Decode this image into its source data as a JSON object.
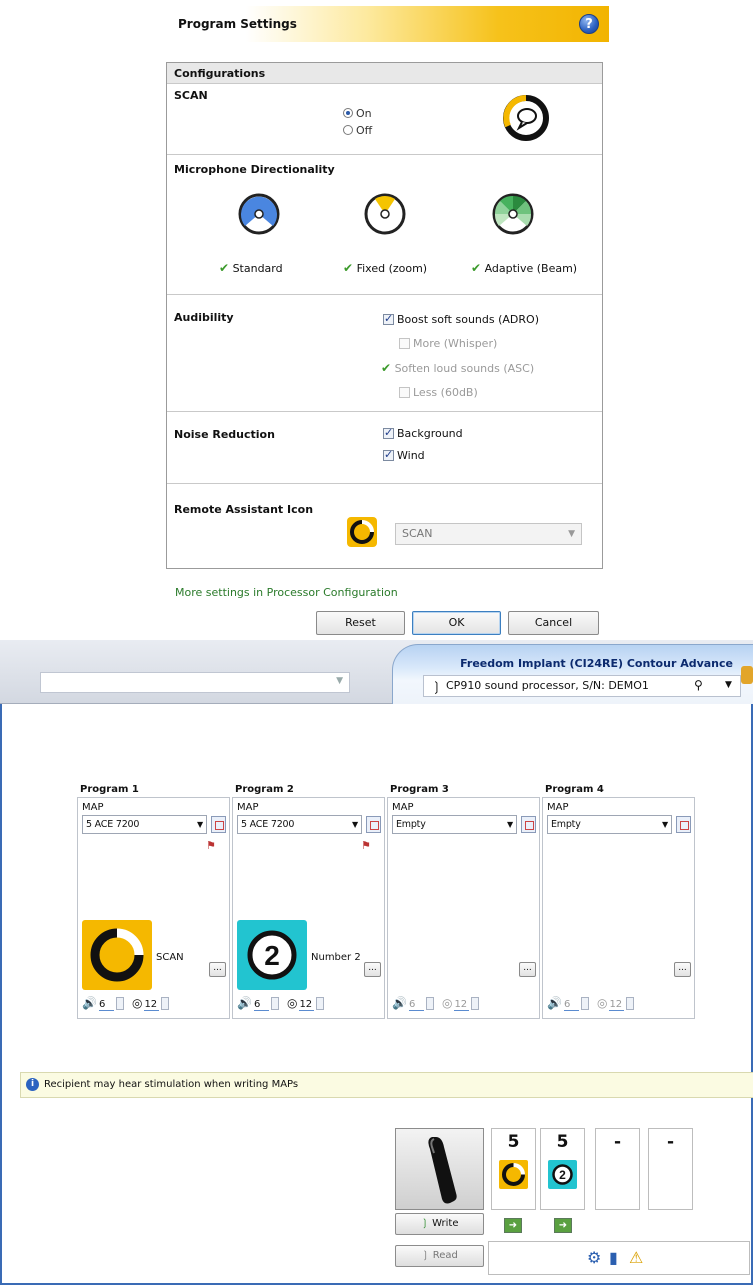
{
  "dialog": {
    "title": "Program Settings",
    "help_icon": "help-icon",
    "configurations_label": "Configurations",
    "scan": {
      "label": "SCAN",
      "options": [
        "On",
        "Off"
      ],
      "selected": "On"
    },
    "mic": {
      "label": "Microphone Directionality",
      "items": [
        {
          "label": "Standard",
          "icon": "standard-mic-icon"
        },
        {
          "label": "Fixed (zoom)",
          "icon": "zoom-mic-icon"
        },
        {
          "label": "Adaptive (Beam)",
          "icon": "beam-mic-icon"
        }
      ]
    },
    "audibility": {
      "label": "Audibility",
      "boost": "Boost soft sounds (ADRO)",
      "more": "More (Whisper)",
      "soften": "Soften loud sounds (ASC)",
      "less": "Less (60dB)"
    },
    "noise": {
      "label": "Noise Reduction",
      "background": "Background",
      "wind": "Wind"
    },
    "remote": {
      "label": "Remote Assistant Icon",
      "value": "SCAN"
    },
    "more_settings": "More settings in Processor Configuration",
    "buttons": {
      "reset": "Reset",
      "ok": "OK",
      "cancel": "Cancel"
    }
  },
  "app": {
    "implant_title": "Freedom Implant (CI24RE) Contour Advance",
    "processor": "CP910 sound processor, S/N: DEMO1",
    "programs": [
      {
        "head": "Program 1",
        "map_label": "MAP",
        "map": "5 ACE 7200",
        "name": "SCAN",
        "vol": "6",
        "sens": "12"
      },
      {
        "head": "Program 2",
        "map_label": "MAP",
        "map": "5 ACE 7200",
        "name": "Number 2",
        "vol": "6",
        "sens": "12"
      },
      {
        "head": "Program 3",
        "map_label": "MAP",
        "map": "Empty",
        "name": "",
        "vol": "6",
        "sens": "12"
      },
      {
        "head": "Program 4",
        "map_label": "MAP",
        "map": "Empty",
        "name": "",
        "vol": "6",
        "sens": "12"
      }
    ],
    "dots": "...",
    "warning": "Recipient may hear stimulation when writing MAPs",
    "slots": [
      "5",
      "5",
      "-",
      "-"
    ],
    "write": "Write",
    "read": "Read",
    "tile_number": "2"
  },
  "colors": {
    "accent_yellow": "#f5b800",
    "accent_cyan": "#22c4d0",
    "header_blue": "#0c2a6e",
    "link_green": "#2a7a2a"
  }
}
